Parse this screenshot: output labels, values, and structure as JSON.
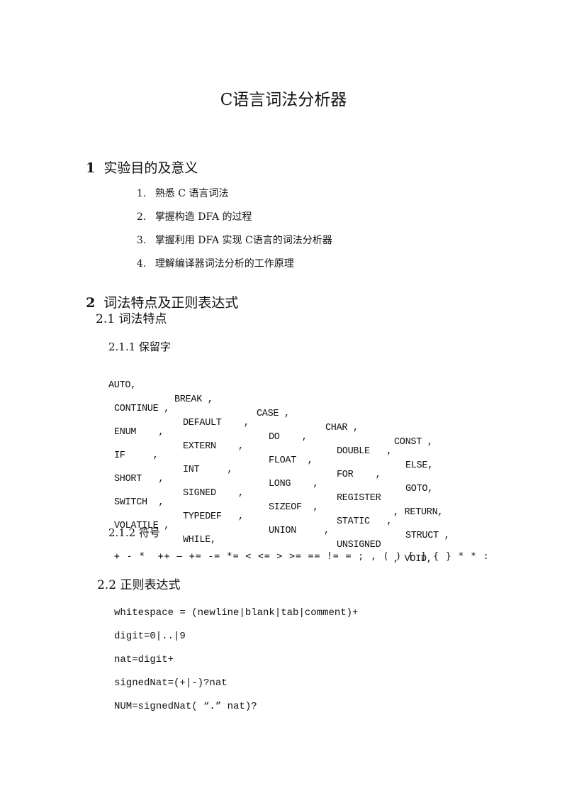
{
  "title": "C语言词法分析器",
  "section1": {
    "number": "1",
    "heading": "实验目的及意义",
    "items": [
      {
        "index": "1.",
        "text": "熟悉 C 语言词法"
      },
      {
        "index": "2.",
        "text": "掌握构造 DFA 的过程"
      },
      {
        "index": "3.",
        "text": "掌握利用 DFA 实现 C语言的词法分析器"
      },
      {
        "index": "4.",
        "text": "理解编译器词法分析的工作原理"
      }
    ]
  },
  "section2": {
    "number": "2",
    "heading": "词法特点及正则表达式",
    "sub1": {
      "heading": "2.1 词法特点",
      "reserved": {
        "heading": "2.1.1 保留字",
        "rows": [
          [
            "AUTO,",
            "BREAK ,",
            "CASE ,",
            "CHAR ,",
            "CONST ,"
          ],
          [
            "CONTINUE ,",
            "DEFAULT    ,",
            "DO    ,",
            "DOUBLE   ,",
            "ELSE,"
          ],
          [
            "ENUM    ,",
            "EXTERN    ,",
            "FLOAT  ,",
            "FOR    ,",
            "GOTO,"
          ],
          [
            "IF     ,",
            "INT     ,",
            "LONG    ,",
            "REGISTER",
            ", RETURN,"
          ],
          [
            "SHORT   ,",
            "SIGNED    ,",
            "SIZEOF  ,",
            "STATIC   ,",
            "STRUCT ,"
          ],
          [
            "SWITCH  ,",
            "TYPEDEF   ,",
            "UNION     ,",
            "UNSIGNED",
            ", VOID,"
          ],
          [
            "VOLATILE ,",
            "WHILE,"
          ]
        ]
      },
      "symbols": {
        "heading": "2.1.2 符号",
        "line": "+ - *  ++ — += -= *= < <= > >= == != = ; , ( ) [ ] { } * * :"
      }
    },
    "sub2": {
      "heading": "2.2 正则表达式",
      "lines": [
        "whitespace = (newline|blank|tab|comment)+",
        "digit=0|..|9",
        "nat=digit+",
        "signedNat=(+|-)?nat",
        "NUM=signedNat( “.” nat)?"
      ]
    }
  }
}
